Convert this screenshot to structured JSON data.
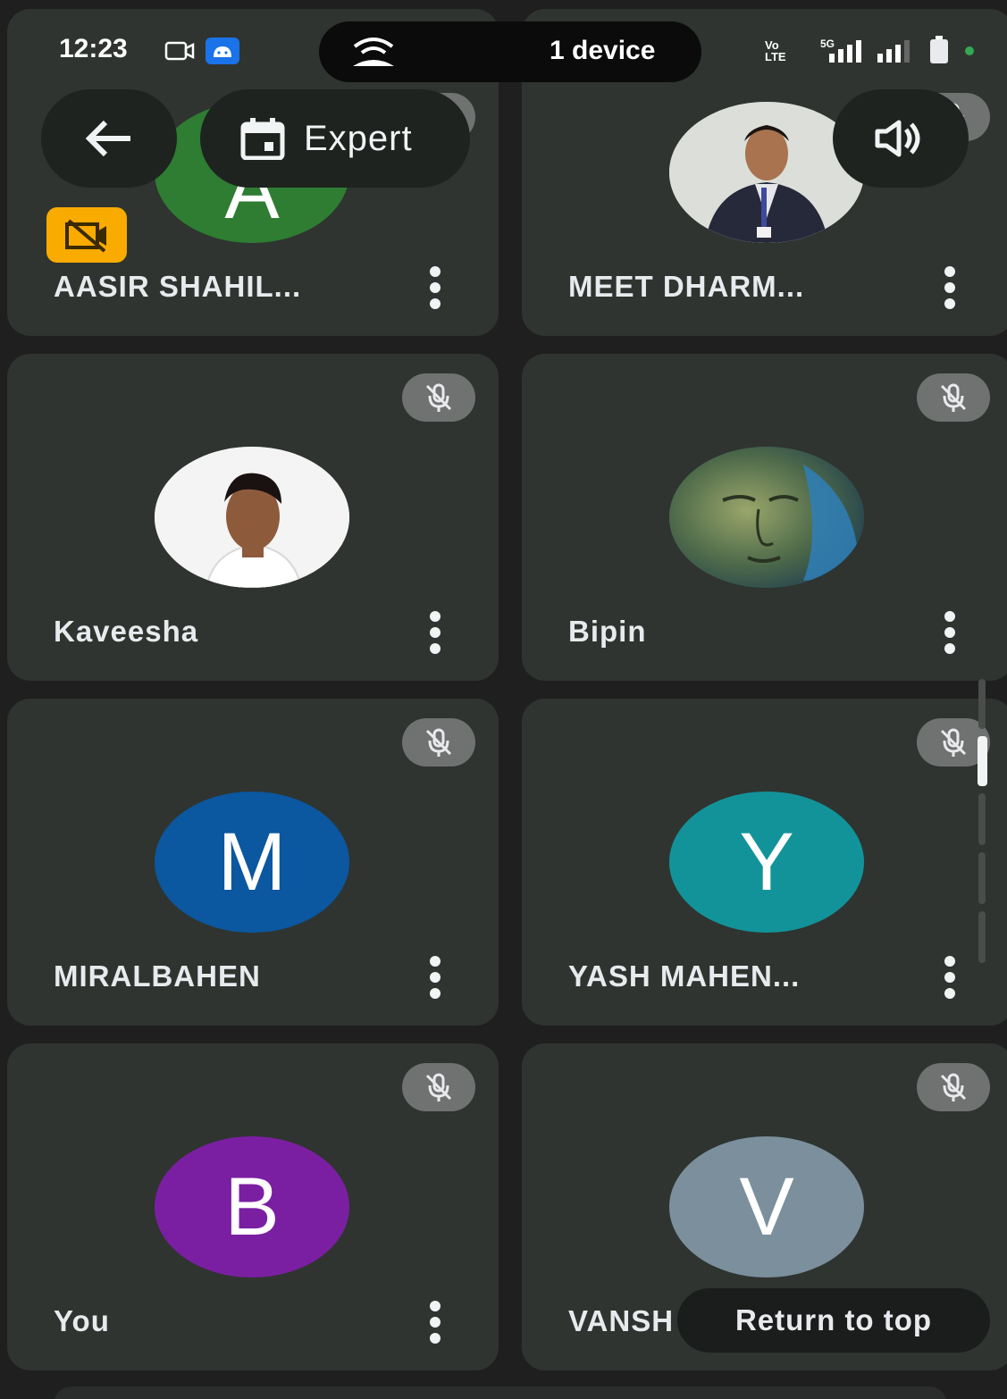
{
  "status_bar": {
    "time": "12:23",
    "devices": "1 device",
    "carrier_top": "Vo",
    "carrier_bottom": "LTE",
    "network": "5G"
  },
  "toolbar": {
    "mode_label": "Expert"
  },
  "participants": [
    {
      "name": "AASIR SHAHIL...",
      "initial": "A",
      "avatar_color": "#2e7d32",
      "mic_muted": true,
      "camera_off_badge": true,
      "photo": false
    },
    {
      "name": "MEET DHARM...",
      "initial": "",
      "avatar_color": "#d9dcd6",
      "mic_muted": true,
      "camera_off_badge": false,
      "photo": true
    },
    {
      "name": "Kaveesha",
      "initial": "",
      "avatar_color": "#f2f2f2",
      "mic_muted": true,
      "camera_off_badge": false,
      "photo": true
    },
    {
      "name": "Bipin",
      "initial": "",
      "avatar_color": "#2f5f6b",
      "mic_muted": true,
      "camera_off_badge": false,
      "photo": true
    },
    {
      "name": "MIRALBAHEN",
      "initial": "M",
      "avatar_color": "#0b57a0",
      "mic_muted": true,
      "camera_off_badge": false,
      "photo": false
    },
    {
      "name": "YASH MAHEN...",
      "initial": "Y",
      "avatar_color": "#12939a",
      "mic_muted": true,
      "camera_off_badge": false,
      "photo": false
    },
    {
      "name": "You",
      "initial": "B",
      "avatar_color": "#7b1fa2",
      "mic_muted": true,
      "camera_off_badge": false,
      "photo": false
    },
    {
      "name": "VANSH",
      "initial": "V",
      "avatar_color": "#7b8f9c",
      "mic_muted": true,
      "camera_off_badge": false,
      "photo": false
    }
  ],
  "return_to_top": "Return to top",
  "colors": {
    "tile_bg": "#2f3430",
    "mic_badge": "#6f7270",
    "camera_badge": "#f9ab00"
  }
}
